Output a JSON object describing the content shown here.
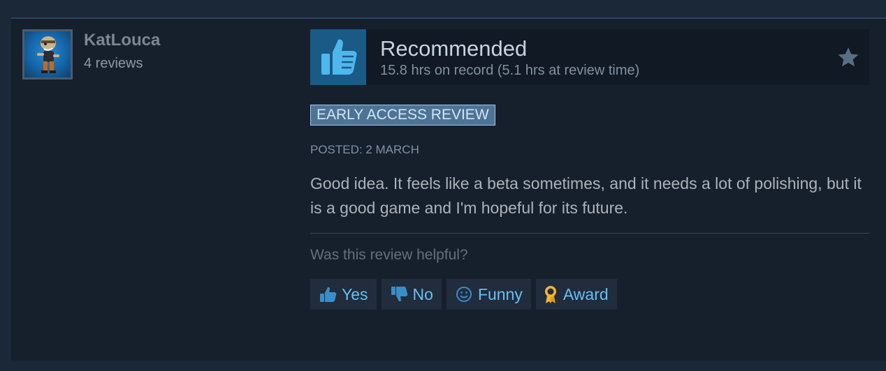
{
  "reviewer": {
    "name": "KatLouca",
    "review_count": "4 reviews",
    "avatar_icon": "character-avatar-icon"
  },
  "verdict": {
    "title": "Recommended",
    "hours": "15.8 hrs on record (5.1 hrs at review time)",
    "icon": "thumbs-up-icon"
  },
  "badge": "EARLY ACCESS REVIEW",
  "posted": "POSTED: 2 MARCH",
  "body": "Good idea. It feels like a beta sometimes, and it needs a lot of polishing, but it is a good game and I'm hopeful for its future.",
  "helpful": {
    "question": "Was this review helpful?",
    "yes_label": "Yes",
    "no_label": "No",
    "funny_label": "Funny",
    "award_label": "Award"
  },
  "colors": {
    "background": "#1b2838",
    "card": "#16202d",
    "accent": "#66c0f4",
    "award": "#f5b630"
  }
}
